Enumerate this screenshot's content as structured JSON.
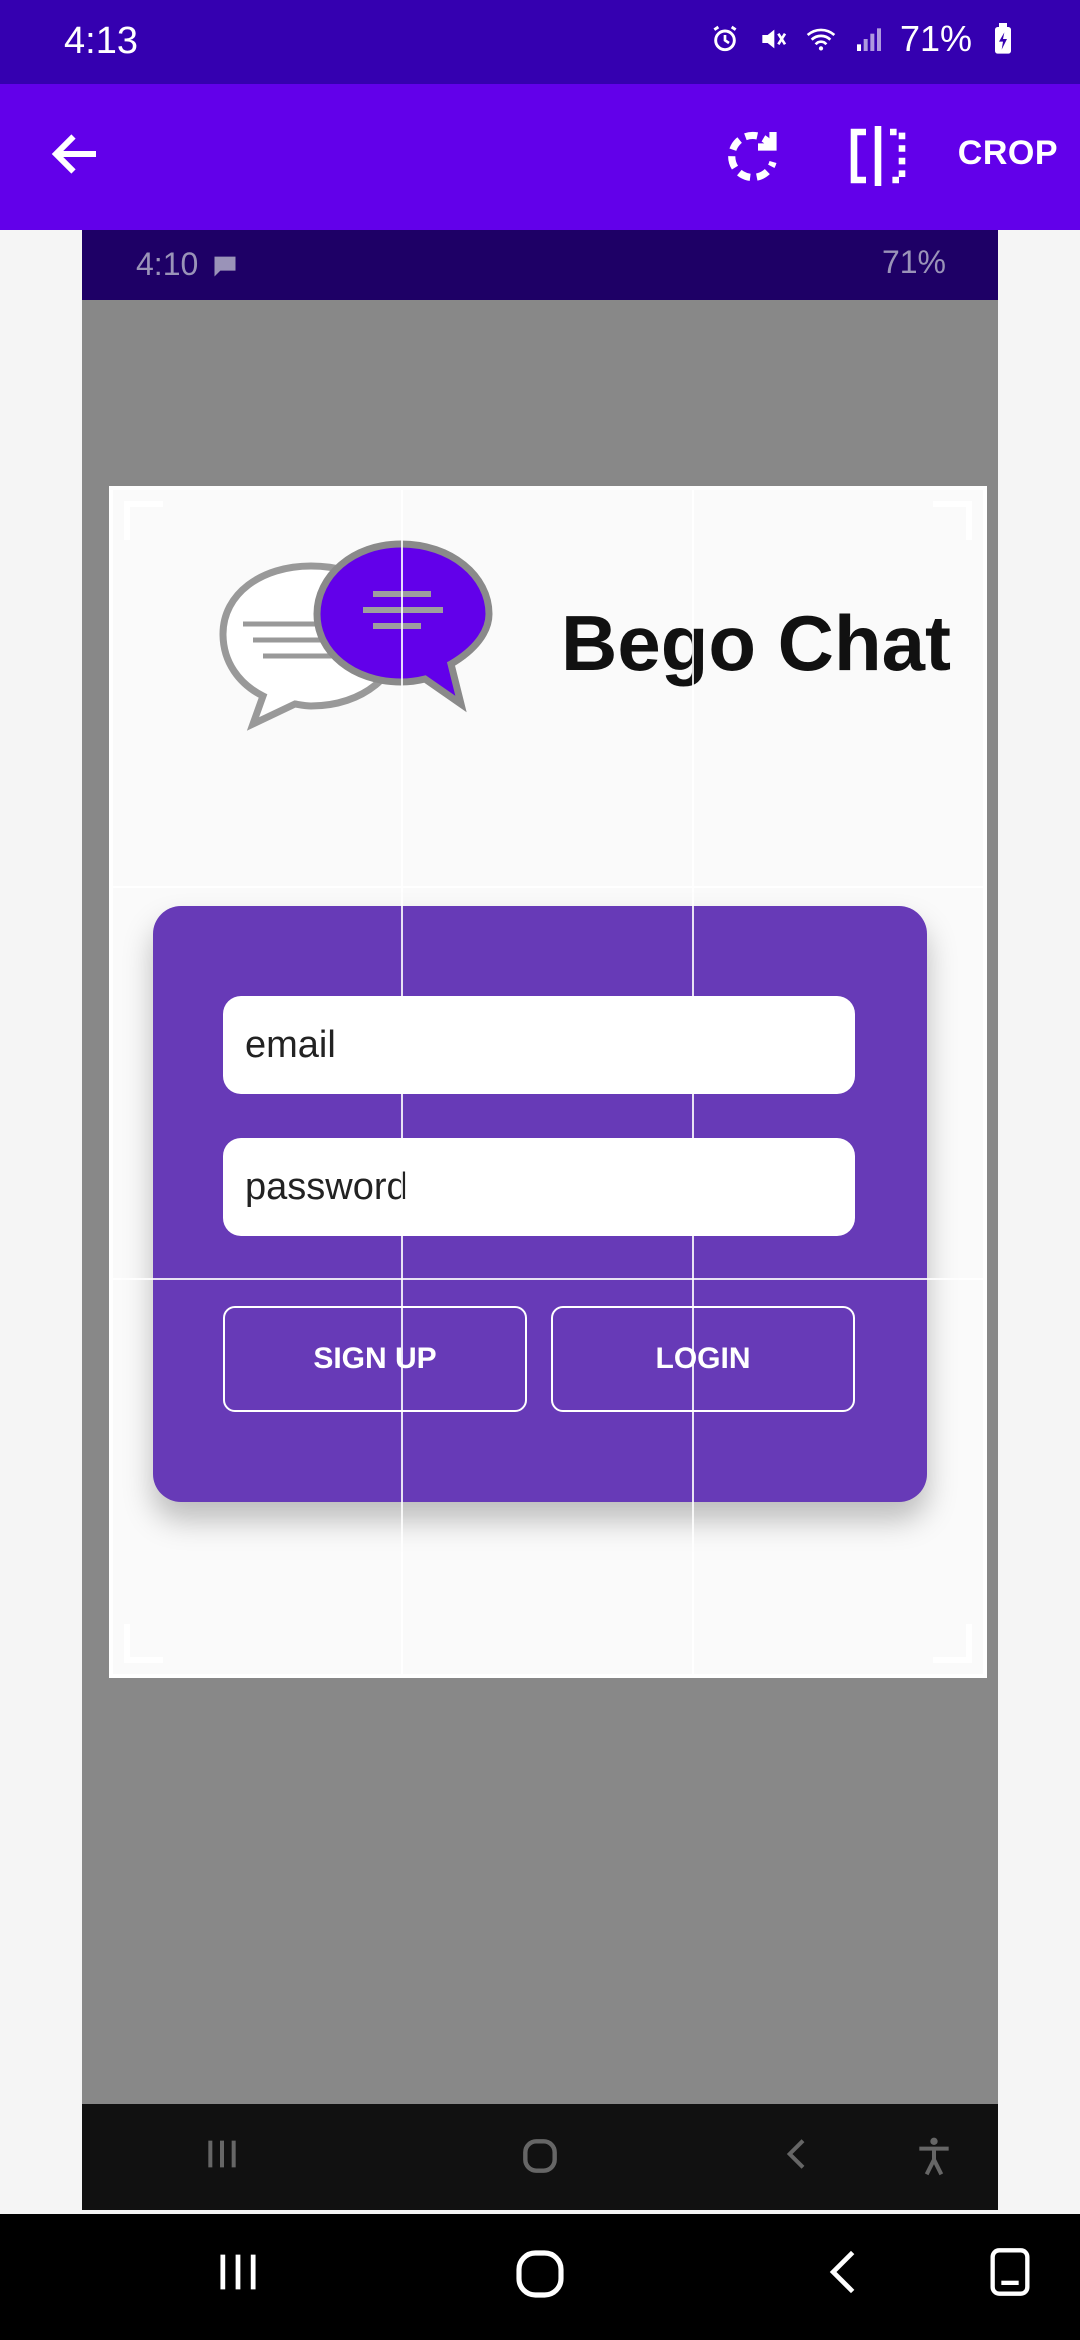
{
  "status_bar": {
    "time": "4:13",
    "battery": "71%",
    "icons": [
      "alarm-icon",
      "mute-icon",
      "wifi-icon",
      "signal-icon",
      "battery-icon"
    ]
  },
  "app_bar": {
    "back_icon": "arrow-left-icon",
    "rotate_icon": "rotate-icon",
    "flip_icon": "flip-icon",
    "crop_label": "CROP"
  },
  "inner_screenshot": {
    "status": {
      "time": "4:10",
      "battery": "71%"
    },
    "app": {
      "brand": "Bego Chat",
      "email_placeholder": "email",
      "password_placeholder": "password",
      "signup_label": "SIGN UP",
      "login_label": "LOGIN"
    }
  },
  "colors": {
    "status_bar": "#3500b0",
    "app_bar": "#6200ea",
    "card": "#673ab7",
    "logo_bubble": "#6200ea"
  }
}
